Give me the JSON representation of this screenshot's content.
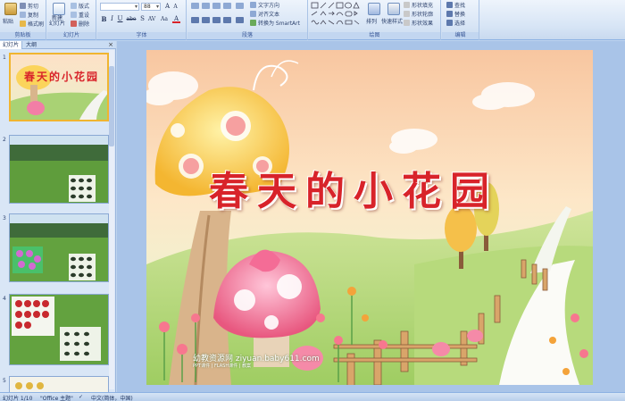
{
  "ribbon": {
    "clipboard": {
      "group_label": "剪贴板",
      "paste": "粘贴",
      "cut": "剪切",
      "copy": "复制",
      "format_painter": "格式刷"
    },
    "slides": {
      "group_label": "幻灯片",
      "new_slide": "新建\n幻灯片",
      "layout": "版式",
      "reset": "重设",
      "delete": "删除"
    },
    "font": {
      "group_label": "字体",
      "font_name": "",
      "font_size": "88",
      "bold": "B",
      "italic": "I",
      "underline": "U",
      "strike": "abe",
      "shadow": "S",
      "spacing": "AV",
      "case": "Aa",
      "color": "A"
    },
    "paragraph": {
      "group_label": "段落",
      "text_direction": "文字方向",
      "align_text": "对齐文本",
      "smartart": "转换为 SmartArt"
    },
    "drawing": {
      "group_label": "绘图",
      "arrange": "排列",
      "quick_styles": "快速样式",
      "shape_fill": "形状填充",
      "shape_outline": "形状轮廓",
      "shape_effects": "形状效果"
    },
    "editing": {
      "group_label": "编辑",
      "find": "查找",
      "replace": "替换",
      "select": "选择"
    }
  },
  "pane": {
    "tab_slides": "幻灯片",
    "tab_outline": "大纲",
    "close": "×"
  },
  "thumbnails": [
    {
      "number": "1",
      "title": "春天的小花园"
    },
    {
      "number": "2"
    },
    {
      "number": "3"
    },
    {
      "number": "4"
    },
    {
      "number": "5"
    }
  ],
  "slide": {
    "title": "春天的小花园",
    "watermark": "幼教资源网 ziyuan.baby611.com",
    "watermark_sub": "PPT课件 | FLASH课件 | 教案"
  },
  "status": {
    "slide_count": "幻灯片 1/10",
    "theme": "\"Office 主题\"",
    "language": "中文(简体，中国)"
  },
  "colors": {
    "title_red": "#d8232a",
    "ribbon_bg": "#d6e4f5",
    "selected_border": "#f0b530"
  }
}
